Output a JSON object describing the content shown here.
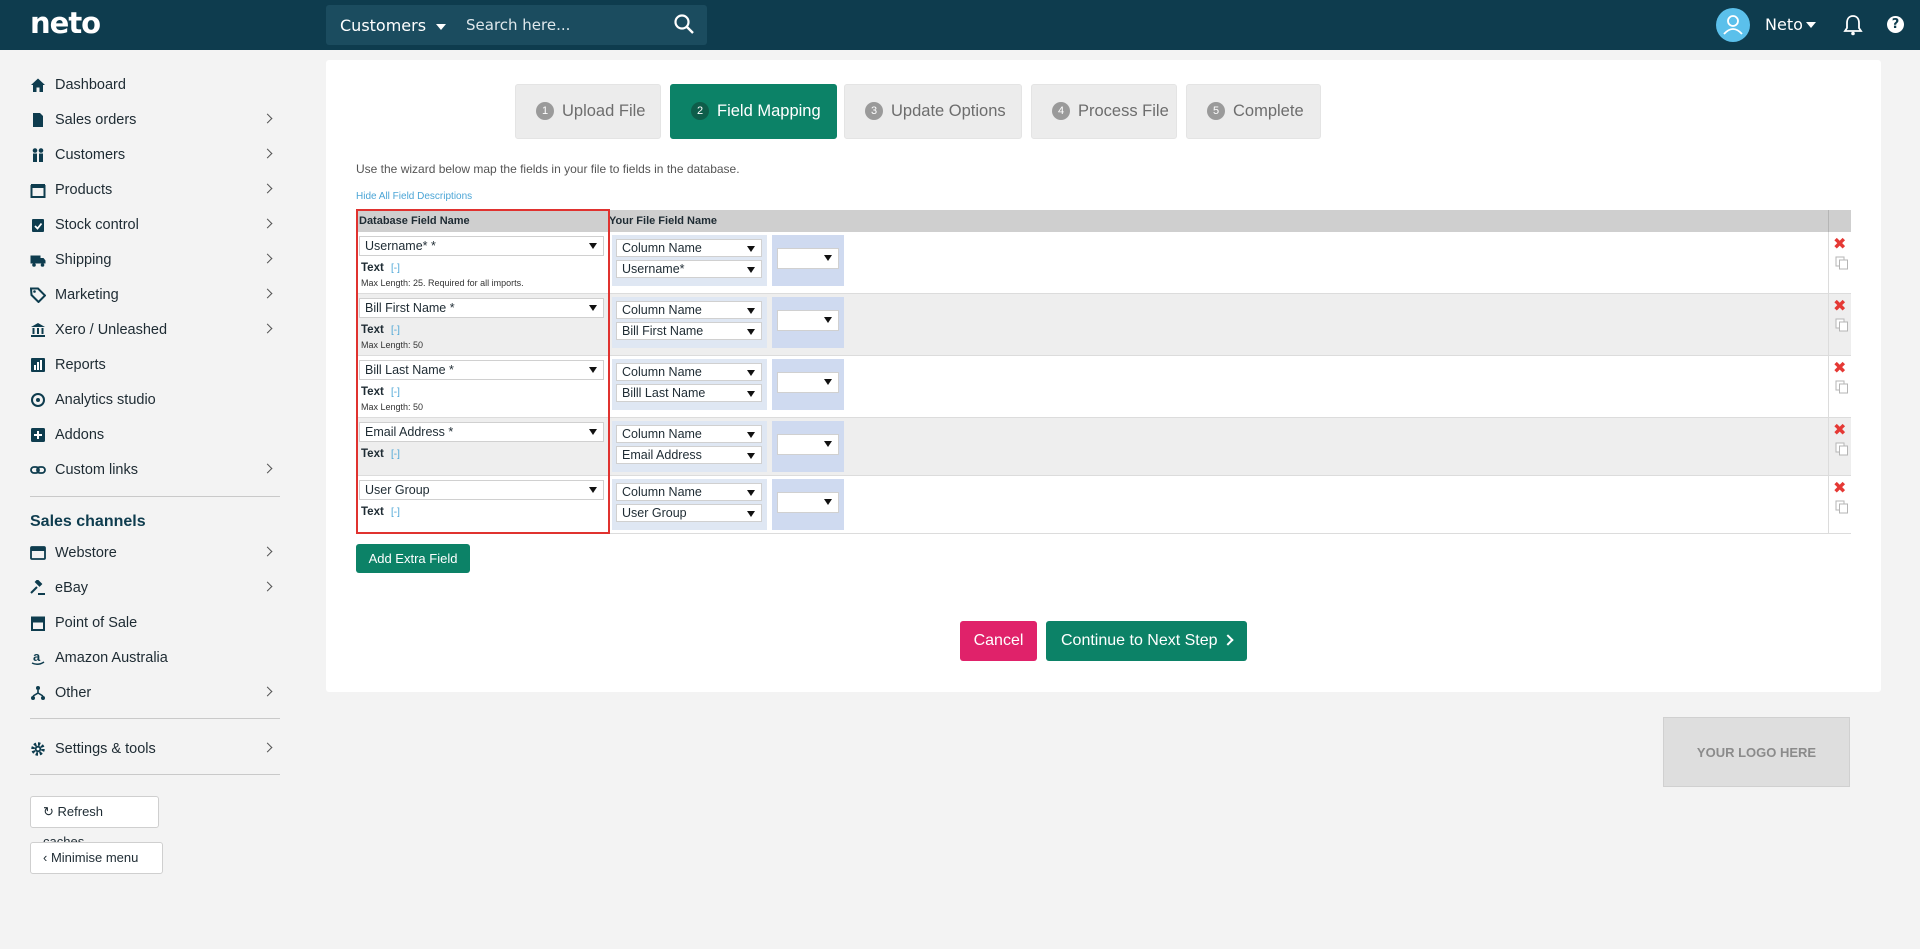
{
  "header": {
    "logo_text": "neto",
    "search_scope": "Customers",
    "search_placeholder": "Search here...",
    "user_name": "Neto",
    "help_symbol": "?"
  },
  "sidebar": {
    "items": [
      {
        "label": "Dashboard",
        "icon": "home-icon"
      },
      {
        "label": "Sales orders",
        "icon": "document-icon"
      },
      {
        "label": "Customers",
        "icon": "people-icon"
      },
      {
        "label": "Products",
        "icon": "box-icon"
      },
      {
        "label": "Stock control",
        "icon": "clipboard-icon"
      },
      {
        "label": "Shipping",
        "icon": "truck-icon"
      },
      {
        "label": "Marketing",
        "icon": "tag-icon"
      },
      {
        "label": "Xero / Unleashed",
        "icon": "bank-icon"
      },
      {
        "label": "Reports",
        "icon": "bar-chart-icon"
      },
      {
        "label": "Analytics studio",
        "icon": "analytics-icon"
      },
      {
        "label": "Addons",
        "icon": "plus-square-icon"
      },
      {
        "label": "Custom links",
        "icon": "link-icon"
      }
    ],
    "sales_channels_heading": "Sales channels",
    "channels": [
      {
        "label": "Webstore",
        "icon": "webstore-icon"
      },
      {
        "label": "eBay",
        "icon": "gavel-icon"
      },
      {
        "label": "Point of Sale",
        "icon": "store-icon"
      },
      {
        "label": "Amazon Australia",
        "icon": "amazon-icon"
      },
      {
        "label": "Other",
        "icon": "fork-icon"
      }
    ],
    "settings_label": "Settings & tools",
    "refresh_label": "Refresh caches",
    "minimise_label": "Minimise menu"
  },
  "wizard": {
    "steps": [
      {
        "num": "1",
        "label": "Upload File",
        "active": false
      },
      {
        "num": "2",
        "label": "Field Mapping",
        "active": true
      },
      {
        "num": "3",
        "label": "Update Options",
        "active": false
      },
      {
        "num": "4",
        "label": "Process File",
        "active": false
      },
      {
        "num": "5",
        "label": "Complete",
        "active": false
      }
    ],
    "intro": "Use the wizard below map the fields in your file to fields in the database.",
    "toggle_descriptions": "Hide All Field Descriptions",
    "col_db": "Database Field Name",
    "col_file": "Your File Field Name",
    "rows": [
      {
        "db_field": "Username* *",
        "type": "Text",
        "toggle": "[-]",
        "note": "Max Length: 25. Required for all imports.",
        "file_type": "Column Name",
        "file_field": "Username*"
      },
      {
        "db_field": "Bill First Name *",
        "type": "Text",
        "toggle": "[-]",
        "note": "Max Length: 50",
        "file_type": "Column Name",
        "file_field": "Bill First Name"
      },
      {
        "db_field": "Bill Last Name *",
        "type": "Text",
        "toggle": "[-]",
        "note": "Max Length: 50",
        "file_type": "Column Name",
        "file_field": "Billl Last Name"
      },
      {
        "db_field": "Email Address *",
        "type": "Text",
        "toggle": "[-]",
        "note": "",
        "file_type": "Column Name",
        "file_field": "Email Address"
      },
      {
        "db_field": "User Group",
        "type": "Text",
        "toggle": "[-]",
        "note": "",
        "file_type": "Column Name",
        "file_field": "User Group"
      }
    ],
    "add_extra_field": "Add Extra Field",
    "cancel": "Cancel",
    "continue": "Continue to Next Step"
  },
  "logo_placeholder": "YOUR LOGO HERE",
  "colors": {
    "topbar": "#0e3c4e",
    "primary_green": "#0c8267",
    "cancel_pink": "#e0226a",
    "highlight_red": "#e0322f"
  }
}
